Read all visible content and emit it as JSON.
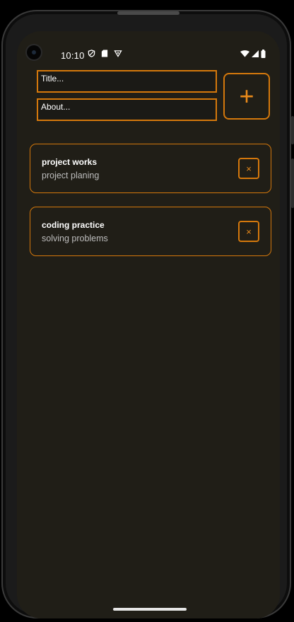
{
  "status_bar": {
    "time": "10:10",
    "icons": [
      "shield-icon",
      "sd-card-icon",
      "data-saver-icon",
      "wifi-icon",
      "signal-icon",
      "battery-icon"
    ]
  },
  "form": {
    "title_placeholder": "Title...",
    "about_placeholder": "About...",
    "add_label": "+"
  },
  "tasks": [
    {
      "title": "project works",
      "about": "project planing",
      "delete_label": "×"
    },
    {
      "title": "coding practice",
      "about": "solving problems",
      "delete_label": "×"
    }
  ],
  "colors": {
    "accent": "#d4780c",
    "background": "#201e17",
    "text": "#ffffff",
    "secondary_text": "#bdbdbd"
  }
}
